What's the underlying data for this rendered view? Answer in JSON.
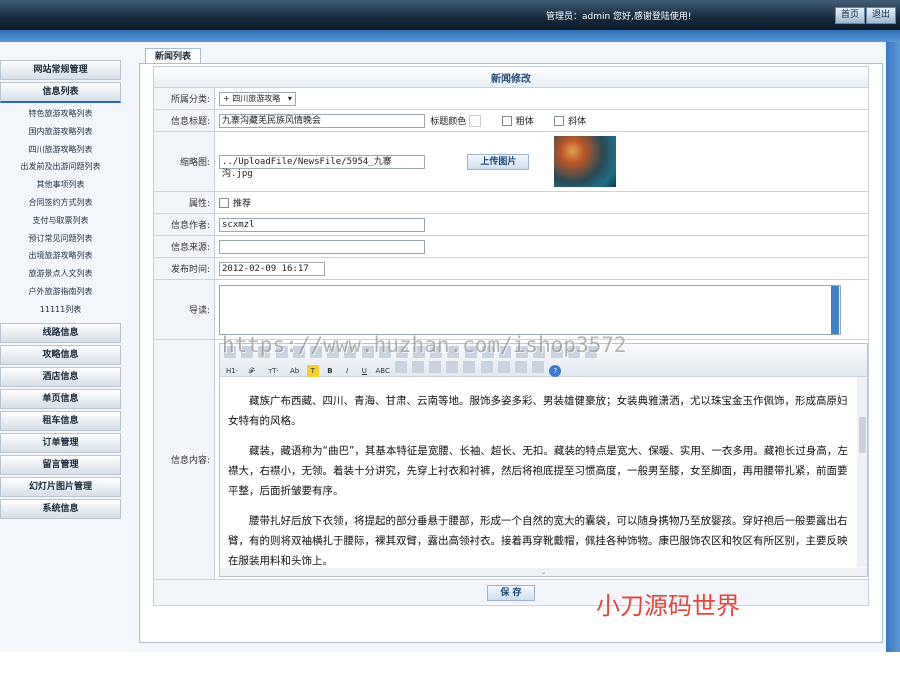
{
  "header": {
    "welcome": "管理员：admin 您好,感谢登陆使用!",
    "home_label": "首页",
    "logout_label": "退出"
  },
  "sidebar": {
    "menus": [
      {
        "label": "网站常规管理"
      },
      {
        "label": "信息列表"
      },
      {
        "label": "线路信息"
      },
      {
        "label": "攻略信息"
      },
      {
        "label": "酒店信息"
      },
      {
        "label": "单页信息"
      },
      {
        "label": "租车信息"
      },
      {
        "label": "订单管理"
      },
      {
        "label": "留言管理"
      },
      {
        "label": "幻灯片图片管理"
      },
      {
        "label": "系统信息"
      }
    ],
    "subitems": [
      "特色旅游攻略列表",
      "国内旅游攻略列表",
      "四川旅游攻略列表",
      "出发前及出游问题列表",
      "其他事项列表",
      "合同签约方式列表",
      "支付与取票列表",
      "预订常见问题列表",
      "出境旅游攻略列表",
      "旅游景点人文列表",
      "户外旅游指南列表",
      "11111列表"
    ]
  },
  "main": {
    "tab": "新闻列表",
    "caption": "新闻修改",
    "category_label": "所属分类:",
    "category_value": "+ 四川旅游攻略",
    "title_label": "信息标题:",
    "title_value": "九寨沟藏羌民族风情晚会",
    "title_color_label": "标题颜色",
    "bold_label": "粗体",
    "italic_label": "斜体",
    "thumb_label": "缩略图:",
    "thumb_path": "../UploadFile/NewsFile/5954_九寨沟.jpg",
    "upload_label": "上传图片",
    "attr_label": "属性:",
    "recommend_label": "推荐",
    "author_label": "信息作者:",
    "author_value": "scxmzl",
    "source_label": "信息来源:",
    "source_value": "",
    "date_label": "发布时间:",
    "date_value": "2012-02-09 16:17",
    "intro_label": "导读:",
    "content_label": "信息内容:",
    "save_label": "保 存",
    "paragraphs": [
      "藏族广布西藏、四川、青海、甘肃、云南等地。服饰多姿多彩、男装雄健豪放；女装典雅潇洒，尤以珠宝金玉作佩饰，形成高原妇女特有的风格。",
      "藏装，藏语称为“曲巴”，其基本特征是宽腰、长袖、超长、无扣。藏装的特点是宽大、保暖、实用、一衣多用。藏袍长过身高，左襟大，右襟小，无领。着装十分讲究，先穿上衬衣和衬裤，然后将袍底提至习惯高度，一般男至膝，女至脚面，再用腰带扎紧，前面要平整，后面折皱要有序。",
      "腰带扎好后放下衣领，将提起的部分垂悬于腰部，形成一个自然的宽大的囊袋，可以随身携物乃至放婴孩。穿好袍后一般要露出右臂，有的则将双袖横扎于腰际，裸其双臂，露出高领衬衣。接着再穿靴戴帽，佩挂各种饰物。康巴服饰农区和牧区有所区别，主要反映在服装用料和头饰上。"
    ],
    "toolbar_h": "H1·",
    "toolbar_f": "𝓕·",
    "toolbar_t": "тT·",
    "toolbar_ab": "Ab",
    "toolbar_b": "B",
    "toolbar_i": "I",
    "toolbar_u": "U",
    "toolbar_abc": "ABC"
  },
  "watermarks": {
    "url": "https://www.huzhan.com/ishop3572",
    "brand": "小刀源码世界"
  }
}
